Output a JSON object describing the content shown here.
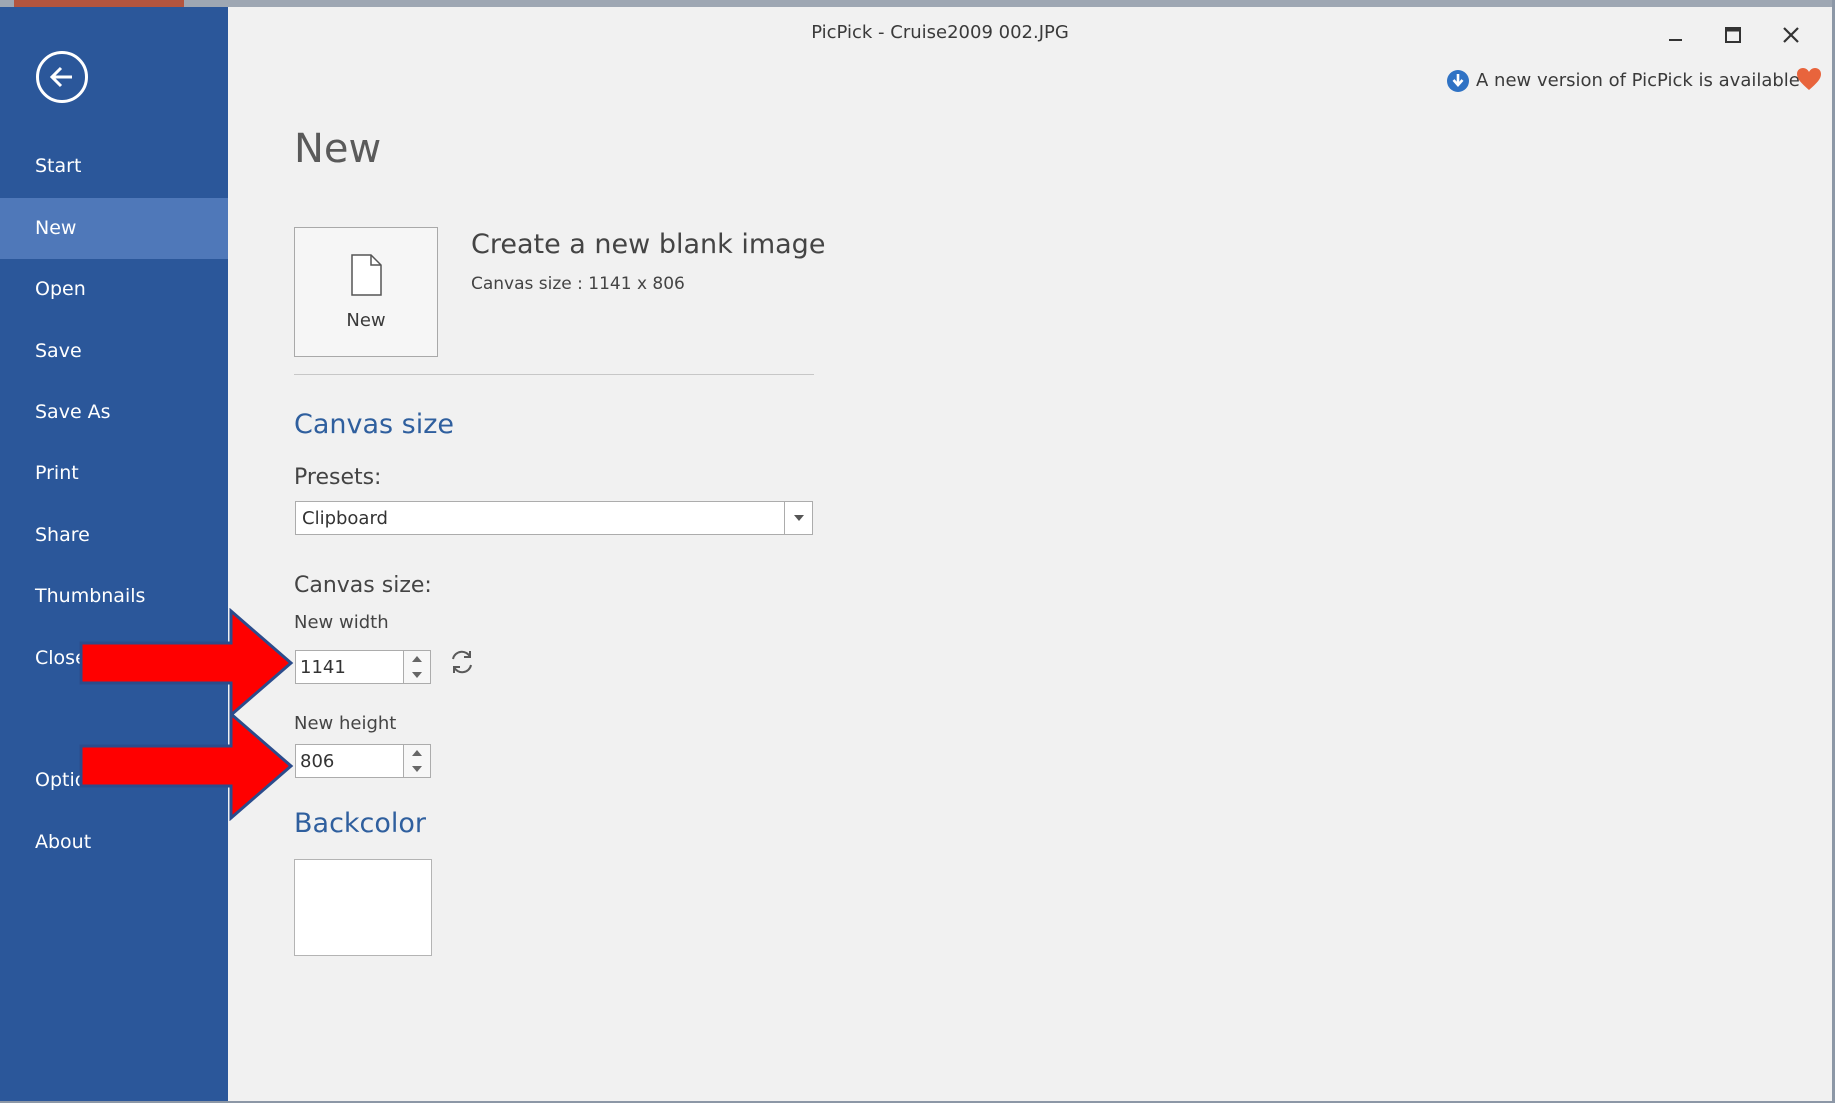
{
  "window": {
    "title": "PicPick - Cruise2009 002.JPG"
  },
  "sidebar": {
    "items": [
      {
        "label": "Start",
        "active": false
      },
      {
        "label": "New",
        "active": true
      },
      {
        "label": "Open",
        "active": false
      },
      {
        "label": "Save",
        "active": false
      },
      {
        "label": "Save As",
        "active": false
      },
      {
        "label": "Print",
        "active": false
      },
      {
        "label": "Share",
        "active": false
      },
      {
        "label": "Thumbnails",
        "active": false
      },
      {
        "label": "Close",
        "active": false
      },
      {
        "label": "Options",
        "active": false
      },
      {
        "label": "About",
        "active": false
      }
    ]
  },
  "notice": {
    "update_text": "A new version of PicPick is available"
  },
  "main": {
    "page_title": "New",
    "new_tile_label": "New",
    "create_title": "Create a new blank image",
    "create_subtitle": "Canvas size : 1141 x 806",
    "canvas_section": {
      "heading": "Canvas size",
      "presets_label": "Presets:",
      "preset_selected": "Clipboard",
      "size_label": "Canvas size:",
      "width_label": "New width",
      "width_value": "1141",
      "height_label": "New height",
      "height_value": "806"
    },
    "backcolor_section": {
      "heading": "Backcolor",
      "color": "#FFFFFF"
    }
  },
  "colors": {
    "sidebar": "#2B579A",
    "sidebar_active": "#4F78B9",
    "section_heading": "#2F5F9E",
    "annotation_arrow": "#FF0000",
    "heart": "#E8643C"
  },
  "icons": {
    "back": "back-arrow-icon",
    "new_file": "blank-document-icon",
    "swap": "swap-dimensions-icon",
    "update": "download-info-icon",
    "heart": "heart-icon",
    "minimize": "minimize-icon",
    "maximize": "maximize-icon",
    "close": "close-icon"
  }
}
